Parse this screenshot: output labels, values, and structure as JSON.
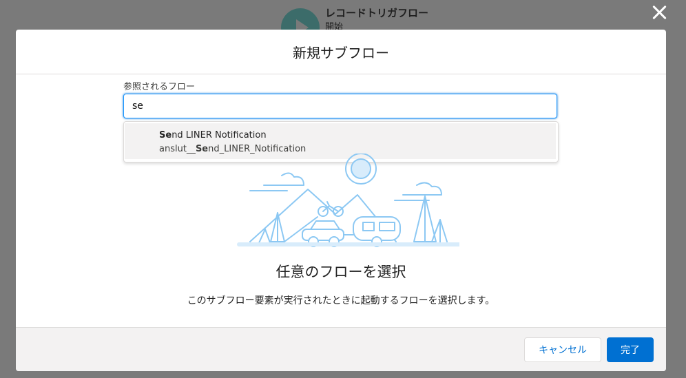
{
  "background": {
    "flow_title": "レコードトリガフロー",
    "flow_subtitle": "開始"
  },
  "modal": {
    "title": "新規サブフロー",
    "field_label": "参照されるフロー",
    "search_value": "se",
    "option": {
      "label_match": "Se",
      "label_rest": "nd LINER Notification",
      "api_prefix": "anslut__",
      "api_match": "Se",
      "api_rest": "nd_LINER_Notification"
    },
    "empty_title": "任意のフローを選択",
    "empty_desc": "このサブフロー要素が実行されたときに起動するフローを選択します。",
    "cancel_label": "キャンセル",
    "done_label": "完了"
  },
  "colors": {
    "brand": "#0070d2",
    "illustration": "#8cc8f3"
  }
}
